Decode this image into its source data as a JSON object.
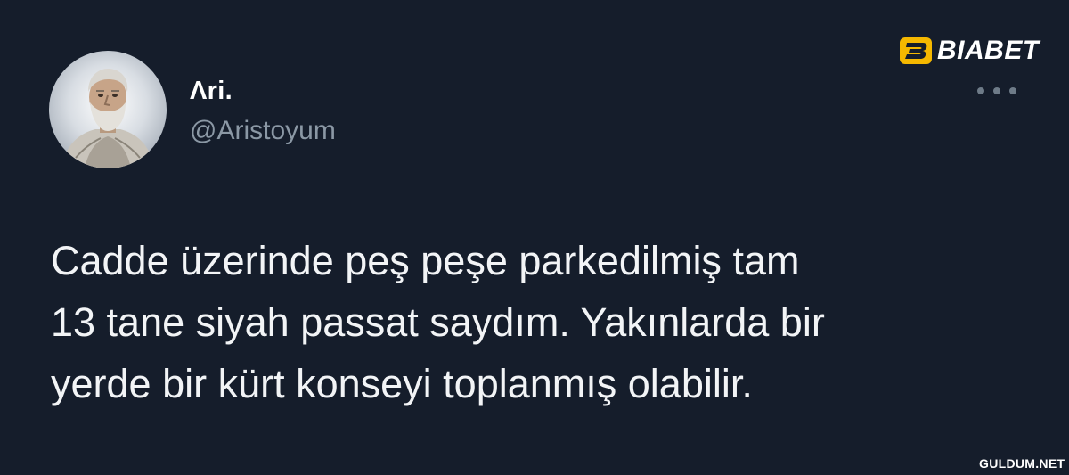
{
  "author": {
    "display_name": "Λri.",
    "handle": "@Aristoyum",
    "avatar_icon": "philosopher-bust-avatar"
  },
  "tweet": {
    "lines": [
      "Cadde üzerinde peş peşe parkedilmiş tam",
      "13 tane siyah passat saydım. Yakınlarda bir",
      "yerde bir kürt konseyi toplanmış olabilir."
    ]
  },
  "menu": {
    "icon": "more-options-icon"
  },
  "brand": {
    "text": "BIABET",
    "accent_color": "#f5b800"
  },
  "watermark": {
    "text": "GULDUM.NET"
  },
  "colors": {
    "background": "#151d2b",
    "secondary_text": "#8b98a5",
    "primary_text": "#ffffff"
  }
}
